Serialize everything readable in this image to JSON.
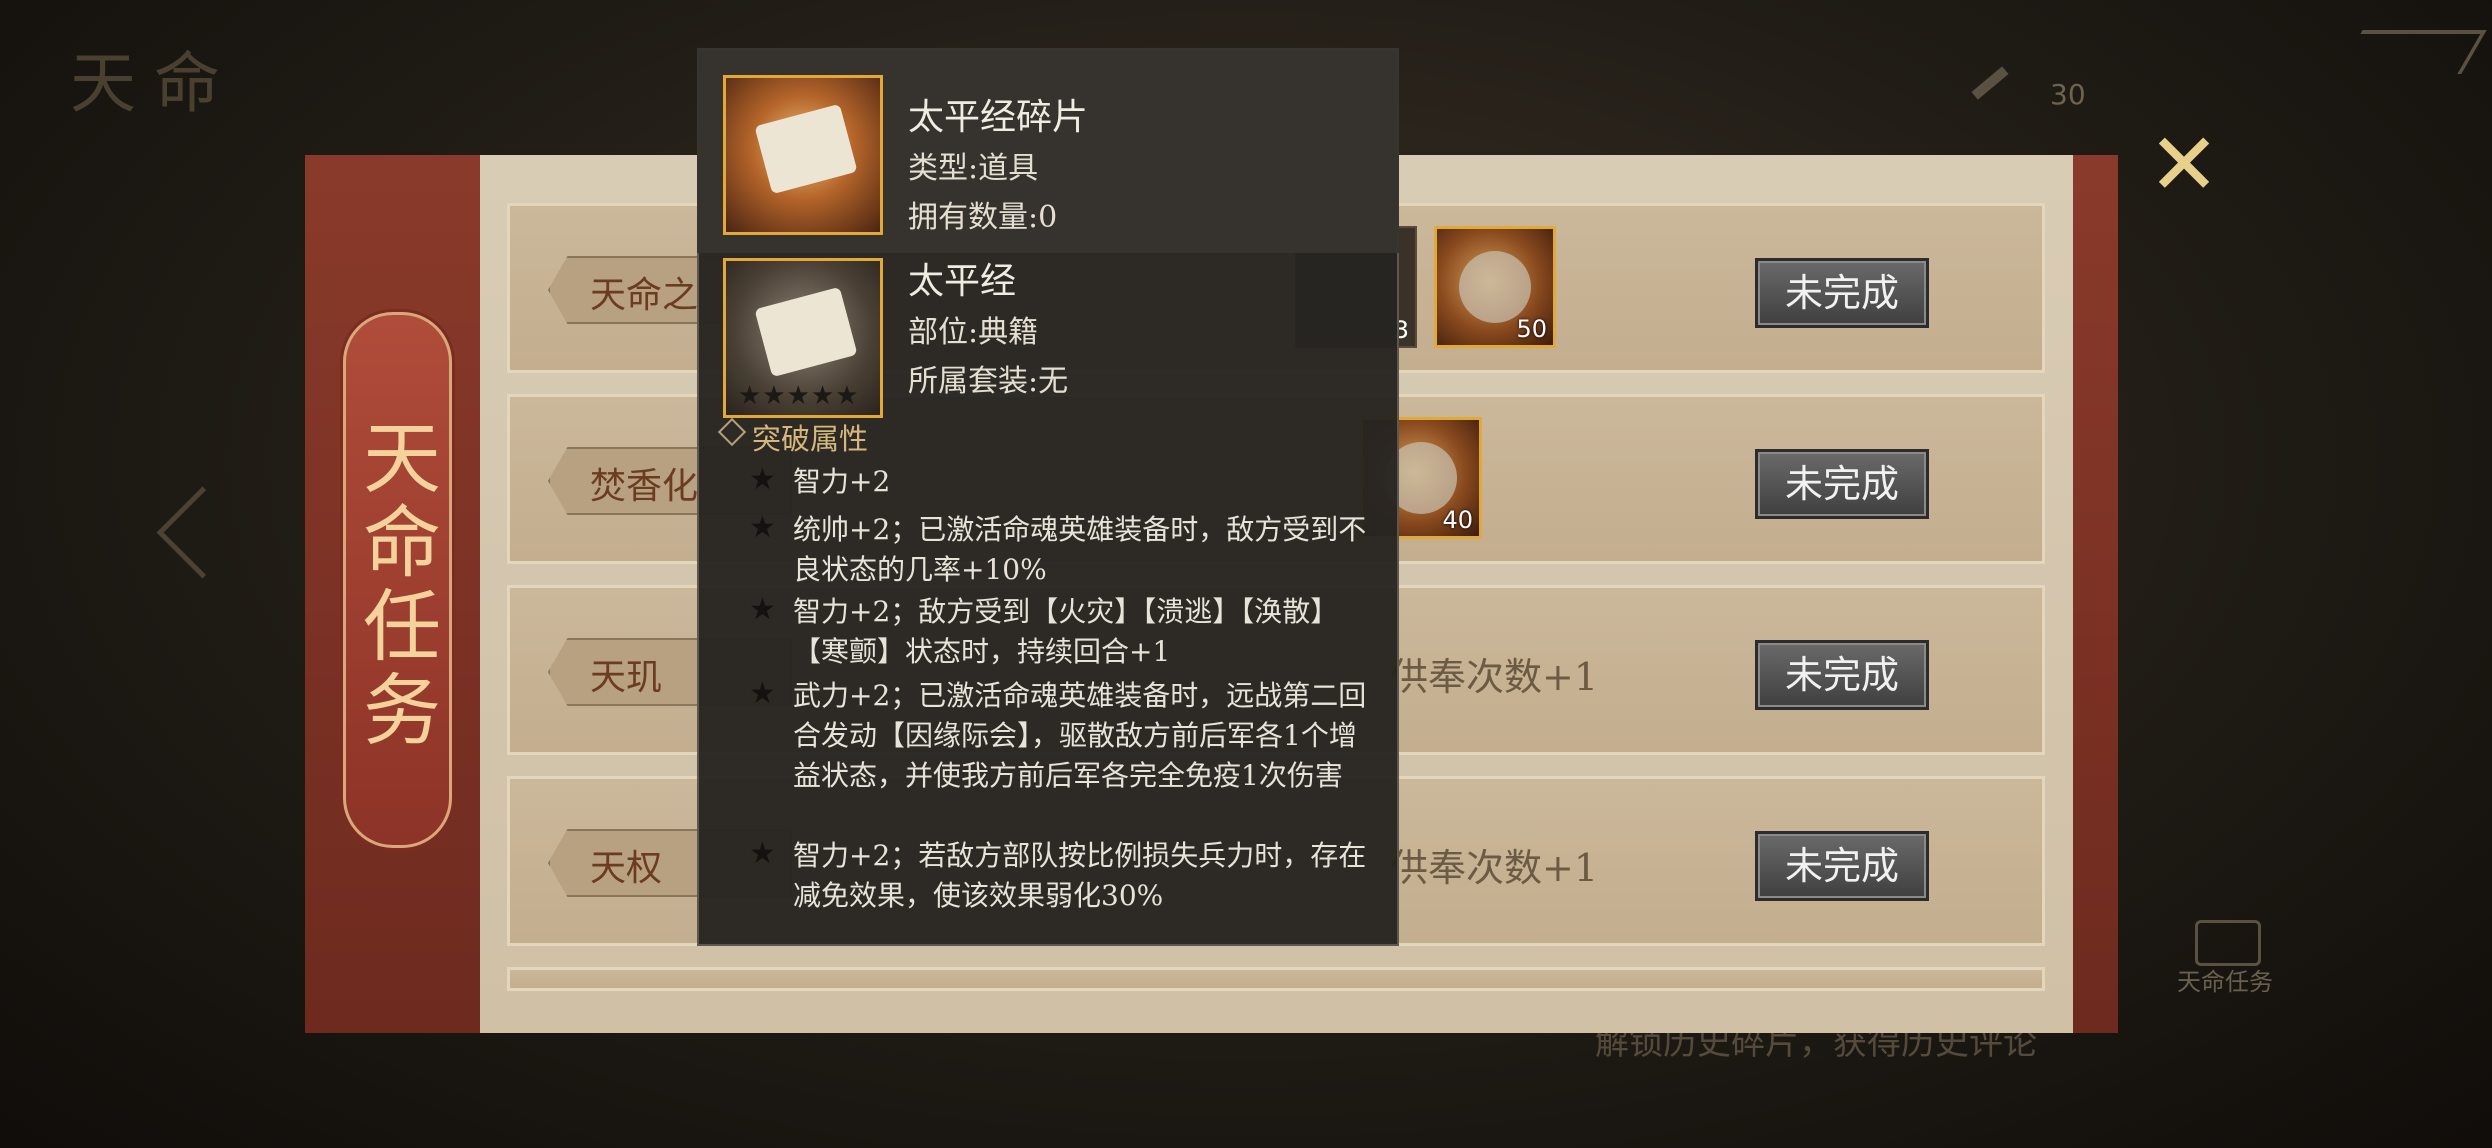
{
  "background": {
    "title": "天命",
    "count": "30",
    "caption": "解锁历史碎片，获得历史评论",
    "badge_label": "天命任务"
  },
  "panel": {
    "title": "天命任务",
    "close_icon": "close-icon"
  },
  "tasks": [
    {
      "tag": "天命之",
      "desc": "",
      "status": "未完成",
      "rewards": [
        {
          "qty": "3"
        },
        {
          "qty": "50"
        }
      ]
    },
    {
      "tag": "焚香化",
      "desc": "",
      "status": "未完成",
      "rewards": [
        {
          "qty": "40"
        }
      ]
    },
    {
      "tag": "天玑",
      "desc": "供奉次数+1",
      "status": "未完成",
      "rewards": []
    },
    {
      "tag": "天权",
      "desc": "供奉次数+1",
      "status": "未完成",
      "rewards": []
    }
  ],
  "tooltip": {
    "item1": {
      "name": "太平经碎片",
      "type_line": "类型:道具",
      "owned_line": "拥有数量:0"
    },
    "item2": {
      "name": "太平经",
      "slot_line": "部位:典籍",
      "set_line": "所属套装:无",
      "stars": "★★★★★"
    },
    "section_title": "突破属性",
    "attributes": [
      "智力+2",
      "统帅+2；已激活命魂英雄装备时，敌方受到不良状态的几率+10%",
      "智力+2；敌方受到【火灾】【溃逃】【涣散】【寒颤】状态时，持续回合+1",
      "武力+2；已激活命魂英雄装备时，远战第二回合发动【因缘际会】，驱散敌方前后军各1个增益状态，并使我方前后军各完全免疫1次伤害",
      "智力+2；若敌方部队按比例损失兵力时，存在减免效果，使该效果弱化30%"
    ]
  }
}
